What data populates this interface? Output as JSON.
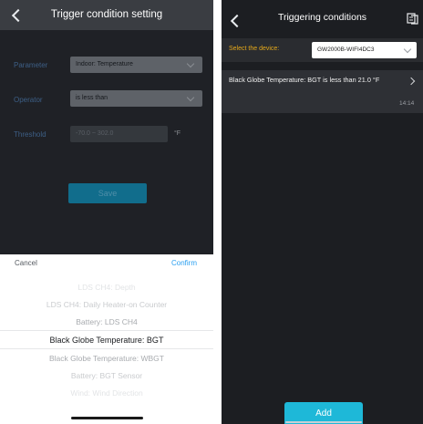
{
  "left": {
    "title": "Trigger condition setting",
    "form": {
      "parameter_label": "Parameter",
      "parameter_value": "Indoor: Temperature",
      "operator_label": "Operator",
      "operator_value": "is less than",
      "threshold_label": "Threshold",
      "threshold_placeholder": "-70.0 ~ 302.0",
      "threshold_unit": "°F",
      "save_label": "Save"
    },
    "picker": {
      "cancel_label": "Cancel",
      "confirm_label": "Confirm",
      "options": [
        "LDS CH4: Depth",
        "LDS CH4: Daily Heater-on Counter",
        "Battery: LDS CH4",
        "Black Globe Temperature: BGT",
        "Black Globe Temperature: WBGT",
        "Battery: BGT Sensor",
        "Wind: Wind Direction"
      ],
      "selected": "Black Globe Temperature: BGT"
    }
  },
  "right": {
    "title": "Triggering conditions",
    "device_label": "Select the device:",
    "device_value": "GW2000B-WIFI4DC3",
    "condition_text": "Black Globe Temperature: BGT is less than 21.0 °F",
    "condition_time": "14:14",
    "add_label": "Add"
  }
}
